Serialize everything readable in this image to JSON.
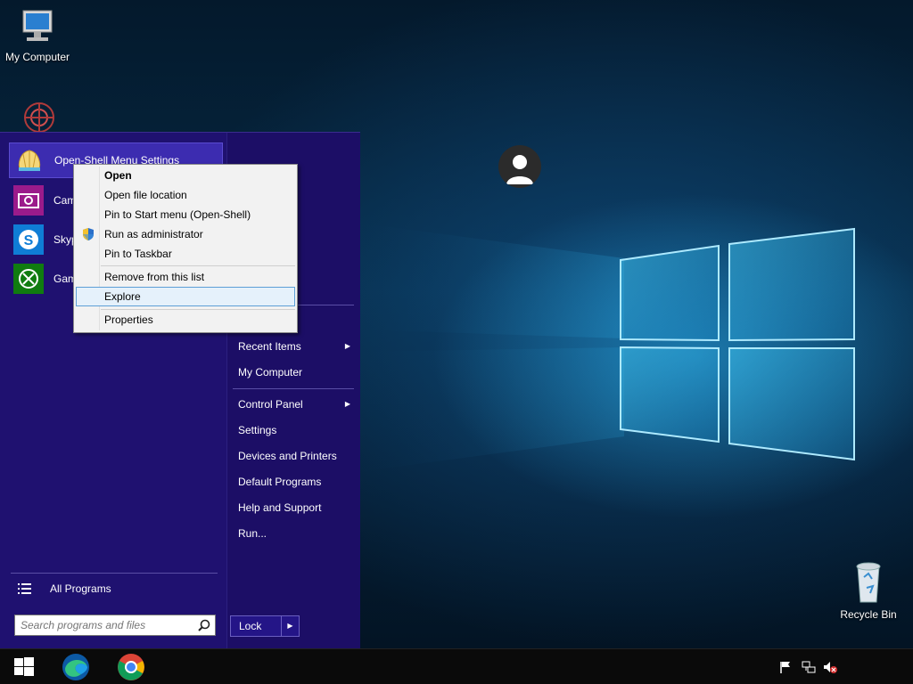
{
  "desktop": {
    "icons": [
      {
        "label": "My Computer",
        "icon": "computer-icon"
      },
      {
        "label": "Recycle Bin",
        "icon": "recycle-bin-icon"
      }
    ]
  },
  "start_menu": {
    "pinned": [
      {
        "label": "Open-Shell Menu Settings",
        "icon": "shell-icon",
        "highlighted": true
      },
      {
        "label": "Camera",
        "icon": "camera-icon"
      },
      {
        "label": "Skype",
        "icon": "skype-icon"
      },
      {
        "label": "Game bar",
        "icon": "xbox-icon"
      }
    ],
    "all_programs": "All Programs",
    "search": {
      "placeholder": "Search programs and files"
    },
    "right": {
      "recent_items": "Recent Items",
      "my_computer": "My Computer",
      "control_panel": "Control Panel",
      "settings": "Settings",
      "devices_printers": "Devices and Printers",
      "default_programs": "Default Programs",
      "help_support": "Help and Support",
      "run": "Run..."
    },
    "lock": "Lock"
  },
  "context_menu": {
    "items": [
      {
        "label": "Open",
        "bold": true
      },
      {
        "label": "Open file location"
      },
      {
        "label": "Pin to Start menu (Open-Shell)"
      },
      {
        "label": "Run as administrator",
        "icon": "uac-shield-icon"
      },
      {
        "label": "Pin to Taskbar"
      },
      {
        "label": "Remove from this list"
      },
      {
        "label": "Explore",
        "hover": true
      },
      {
        "label": "Properties"
      }
    ]
  },
  "taskbar": {
    "apps": [
      "windows-start-icon",
      "edge-icon",
      "chrome-icon"
    ],
    "tray": [
      "action-center-flag-icon",
      "network-icon",
      "volume-muted-icon"
    ]
  },
  "colors": {
    "start_menu_bg": "#1f1170",
    "highlight": "#3c2cb0",
    "context_hover_border": "#5d9fd6"
  }
}
